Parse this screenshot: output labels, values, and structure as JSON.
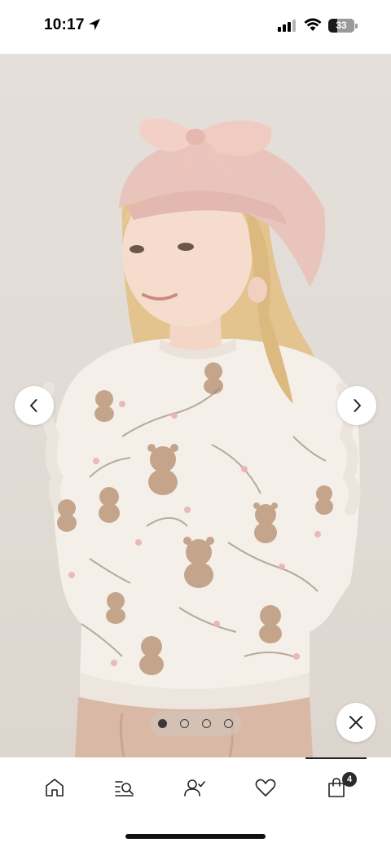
{
  "status_bar": {
    "time": "10:17",
    "battery_level": "33",
    "icons": [
      "location-arrow-icon",
      "signal-icon",
      "wifi-icon",
      "battery-icon"
    ]
  },
  "gallery": {
    "image_description_icon": "product-photo",
    "page_count": 4,
    "active_page": 1,
    "prev_icon": "chevron-left-icon",
    "next_icon": "chevron-right-icon",
    "close_icon": "close-icon"
  },
  "tab_bar": {
    "tabs": [
      {
        "icon": "home-icon"
      },
      {
        "icon": "search-icon"
      },
      {
        "icon": "account-icon"
      },
      {
        "icon": "heart-icon"
      },
      {
        "icon": "bag-icon"
      }
    ],
    "bag_count": "4",
    "active_tab": "bag"
  },
  "colors": {
    "background": "#e1dbd5",
    "sweater": "#f4efe9",
    "beret": "#e8c4bd",
    "accent": "#2b2b2b"
  }
}
